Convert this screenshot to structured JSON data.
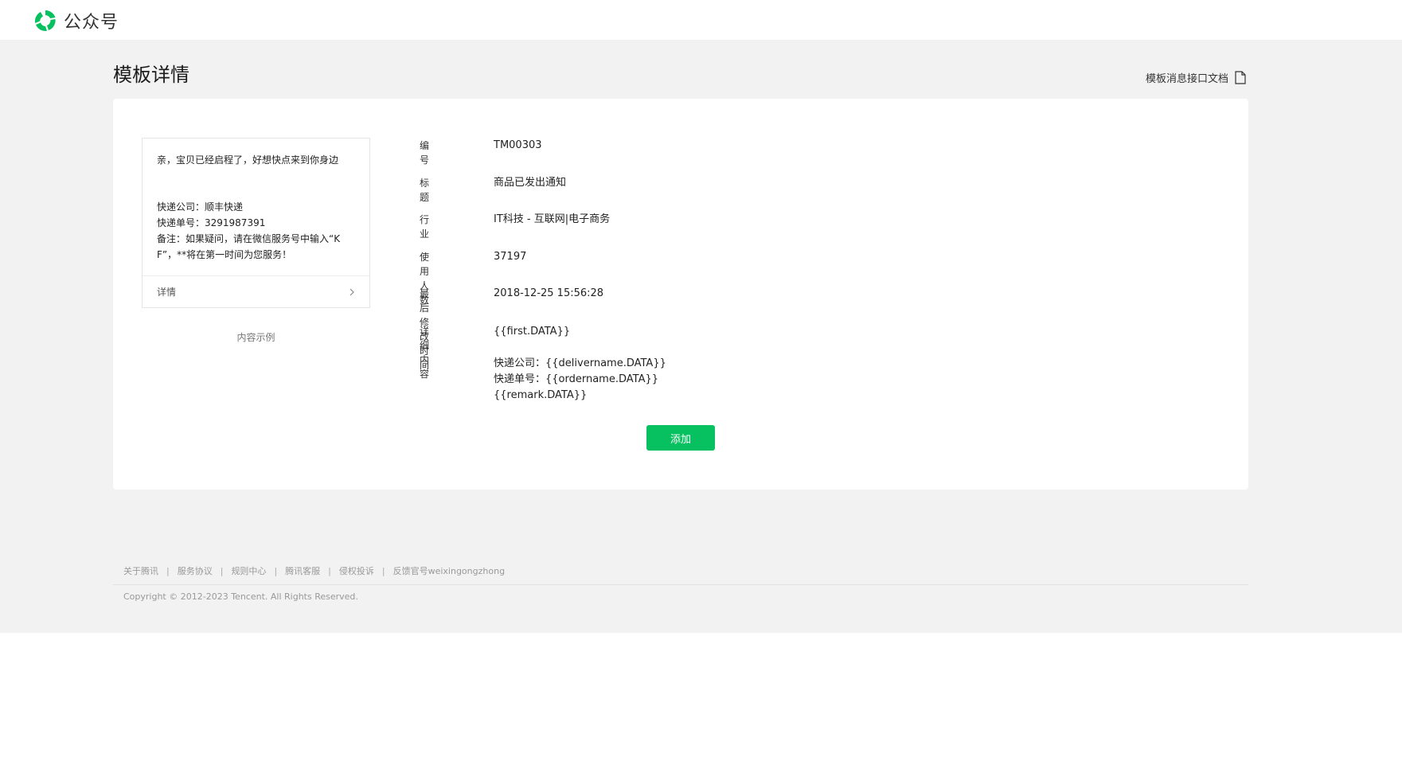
{
  "header": {
    "app_name": "公众号",
    "logo_icon": "wechat-official-account-logo",
    "brand_color": "#07c160"
  },
  "page": {
    "title": "模板详情",
    "doc_link": "模板消息接口文档",
    "doc_icon": "document-icon"
  },
  "preview": {
    "first": "亲，宝贝已经启程了，好想快点来到你身边",
    "lines": [
      "快递公司：顺丰快递",
      "快递单号：3291987391",
      "备注：如果疑问，请在微信服务号中输入“K",
      "F”，**将在第一时间为您服务！"
    ],
    "footer_label": "详情",
    "caption": "内容示例"
  },
  "info": {
    "number_label": "编号",
    "number_value": "TM00303",
    "title_label": "标题",
    "title_value": "商品已发出通知",
    "industry_label": "行业",
    "industry_value": "IT科技 - 互联网|电子商务",
    "users_label": "使用人数",
    "users_value": "37197",
    "modified_label": "最后修改时间",
    "modified_value": "2018-12-25 15:56:28",
    "detail_label": "详细内容",
    "detail_first": "{{first.DATA}}",
    "detail_lines": [
      "快递公司：{{delivername.DATA}}",
      "快递单号：{{ordername.DATA}}",
      "{{remark.DATA}}"
    ]
  },
  "actions": {
    "add_label": "添加"
  },
  "footer": {
    "links": [
      "关于腾讯",
      "服务协议",
      "规则中心",
      "腾讯客服",
      "侵权投诉",
      "反馈官号weixingongzhong"
    ],
    "separator": "|",
    "copyright": "Copyright © 2012-2023 Tencent. All Rights Reserved."
  }
}
